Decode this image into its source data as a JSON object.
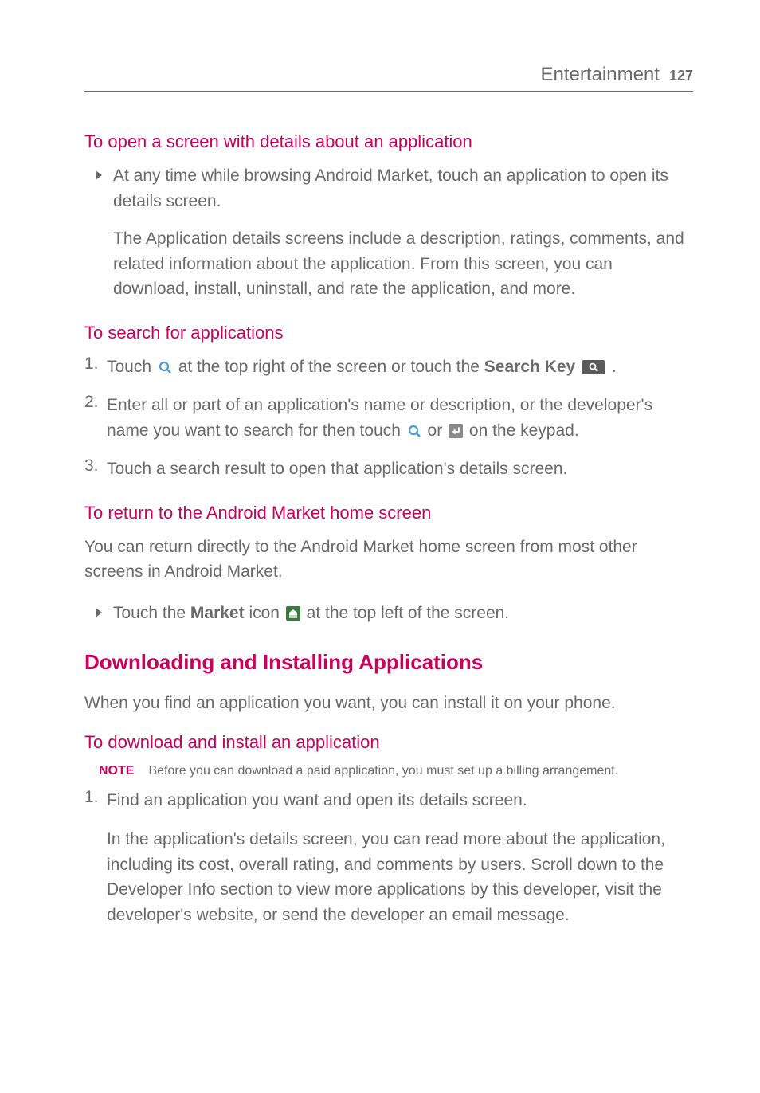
{
  "header": {
    "title": "Entertainment",
    "page": "127"
  },
  "s1": {
    "head": "To open a screen with details about an application",
    "b1": "At any time while browsing Android Market, touch an application to open its details screen.",
    "b1p": "The Application details screens include a description, ratings, comments, and related information about the application. From this screen, you can download, install, uninstall, and rate the application, and more."
  },
  "s2": {
    "head": "To search for applications",
    "n1a": "Touch ",
    "n1b": " at the top right of the screen or touch the ",
    "n1c": "Search Key",
    "n1d": " ",
    "n1e": " .",
    "n2a": "Enter all or part of an application's name or description, or the developer's name you want to search for then touch ",
    "n2b": " or ",
    "n2c": " on the keypad.",
    "n3": "Touch a search result to open that application's details screen."
  },
  "s3": {
    "head": "To return to the Android Market home screen",
    "p": "You can return directly to the Android Market home screen from most other screens in Android Market.",
    "b1a": "Touch the ",
    "b1b": "Market",
    "b1c": " icon ",
    "b1d": " at the top left of the screen."
  },
  "major": "Downloading and Installing Applications",
  "majorp": "When you find an application you want, you can install it on your phone.",
  "s4": {
    "head": "To download and install an application",
    "noteLabel": "NOTE",
    "noteText": "Before you can download a paid application, you must set up a billing arrangement.",
    "n1": "Find an application you want and open its details screen.",
    "n1p": "In the application's details screen, you can read more about the application, including its cost, overall rating, and comments by users. Scroll down to the Developer Info section to view more applications by this developer, visit the developer's website, or send the developer an email message."
  }
}
